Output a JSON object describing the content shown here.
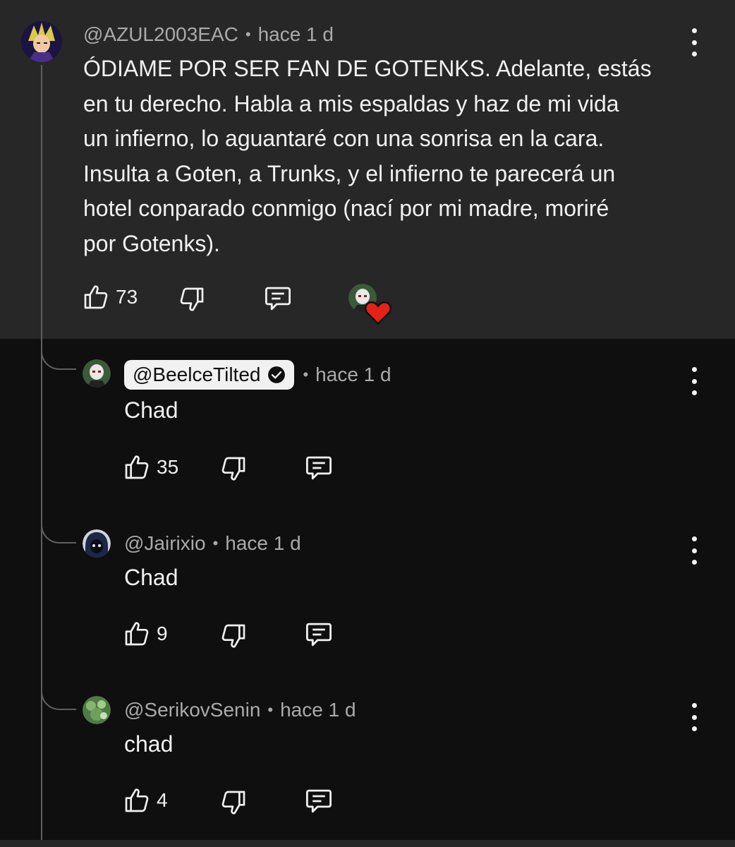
{
  "top_comment": {
    "author": "@AZUL2003EAC",
    "time": "hace 1 d",
    "text": "ÓDIAME POR SER FAN DE GOTENKS. Adelante, estás\nen tu derecho. Habla a mis espaldas y haz de mi vida\nun infierno, lo aguantaré con una sonrisa en la cara.\nInsulta a Goten, a Trunks, y el infierno te parecerá un\nhotel conparado conmigo (nací por mi madre, moriré\npor Gotenks).",
    "likes": "73"
  },
  "replies": [
    {
      "author": "@BeelceTilted",
      "verified": true,
      "time": "hace 1 d",
      "text": "Chad",
      "likes": "35"
    },
    {
      "author": "@Jairixio",
      "time": "hace 1 d",
      "text": "Chad",
      "likes": "9"
    },
    {
      "author": "@SerikovSenin",
      "time": "hace 1 d",
      "text": "chad",
      "likes": "4"
    }
  ],
  "separator": "•",
  "icons": {
    "like": "thumb-up-icon",
    "dislike": "thumb-down-icon",
    "reply": "comment-icon",
    "more": "more-vert-icon",
    "verified": "check-circle-icon",
    "creator_heart": "heart-icon"
  },
  "colors": {
    "page_bg": "#0f0f0f",
    "highlight_bg": "#272727",
    "text": "#f1f1f1",
    "secondary_text": "#aaaaaa",
    "heart": "#e62117"
  }
}
